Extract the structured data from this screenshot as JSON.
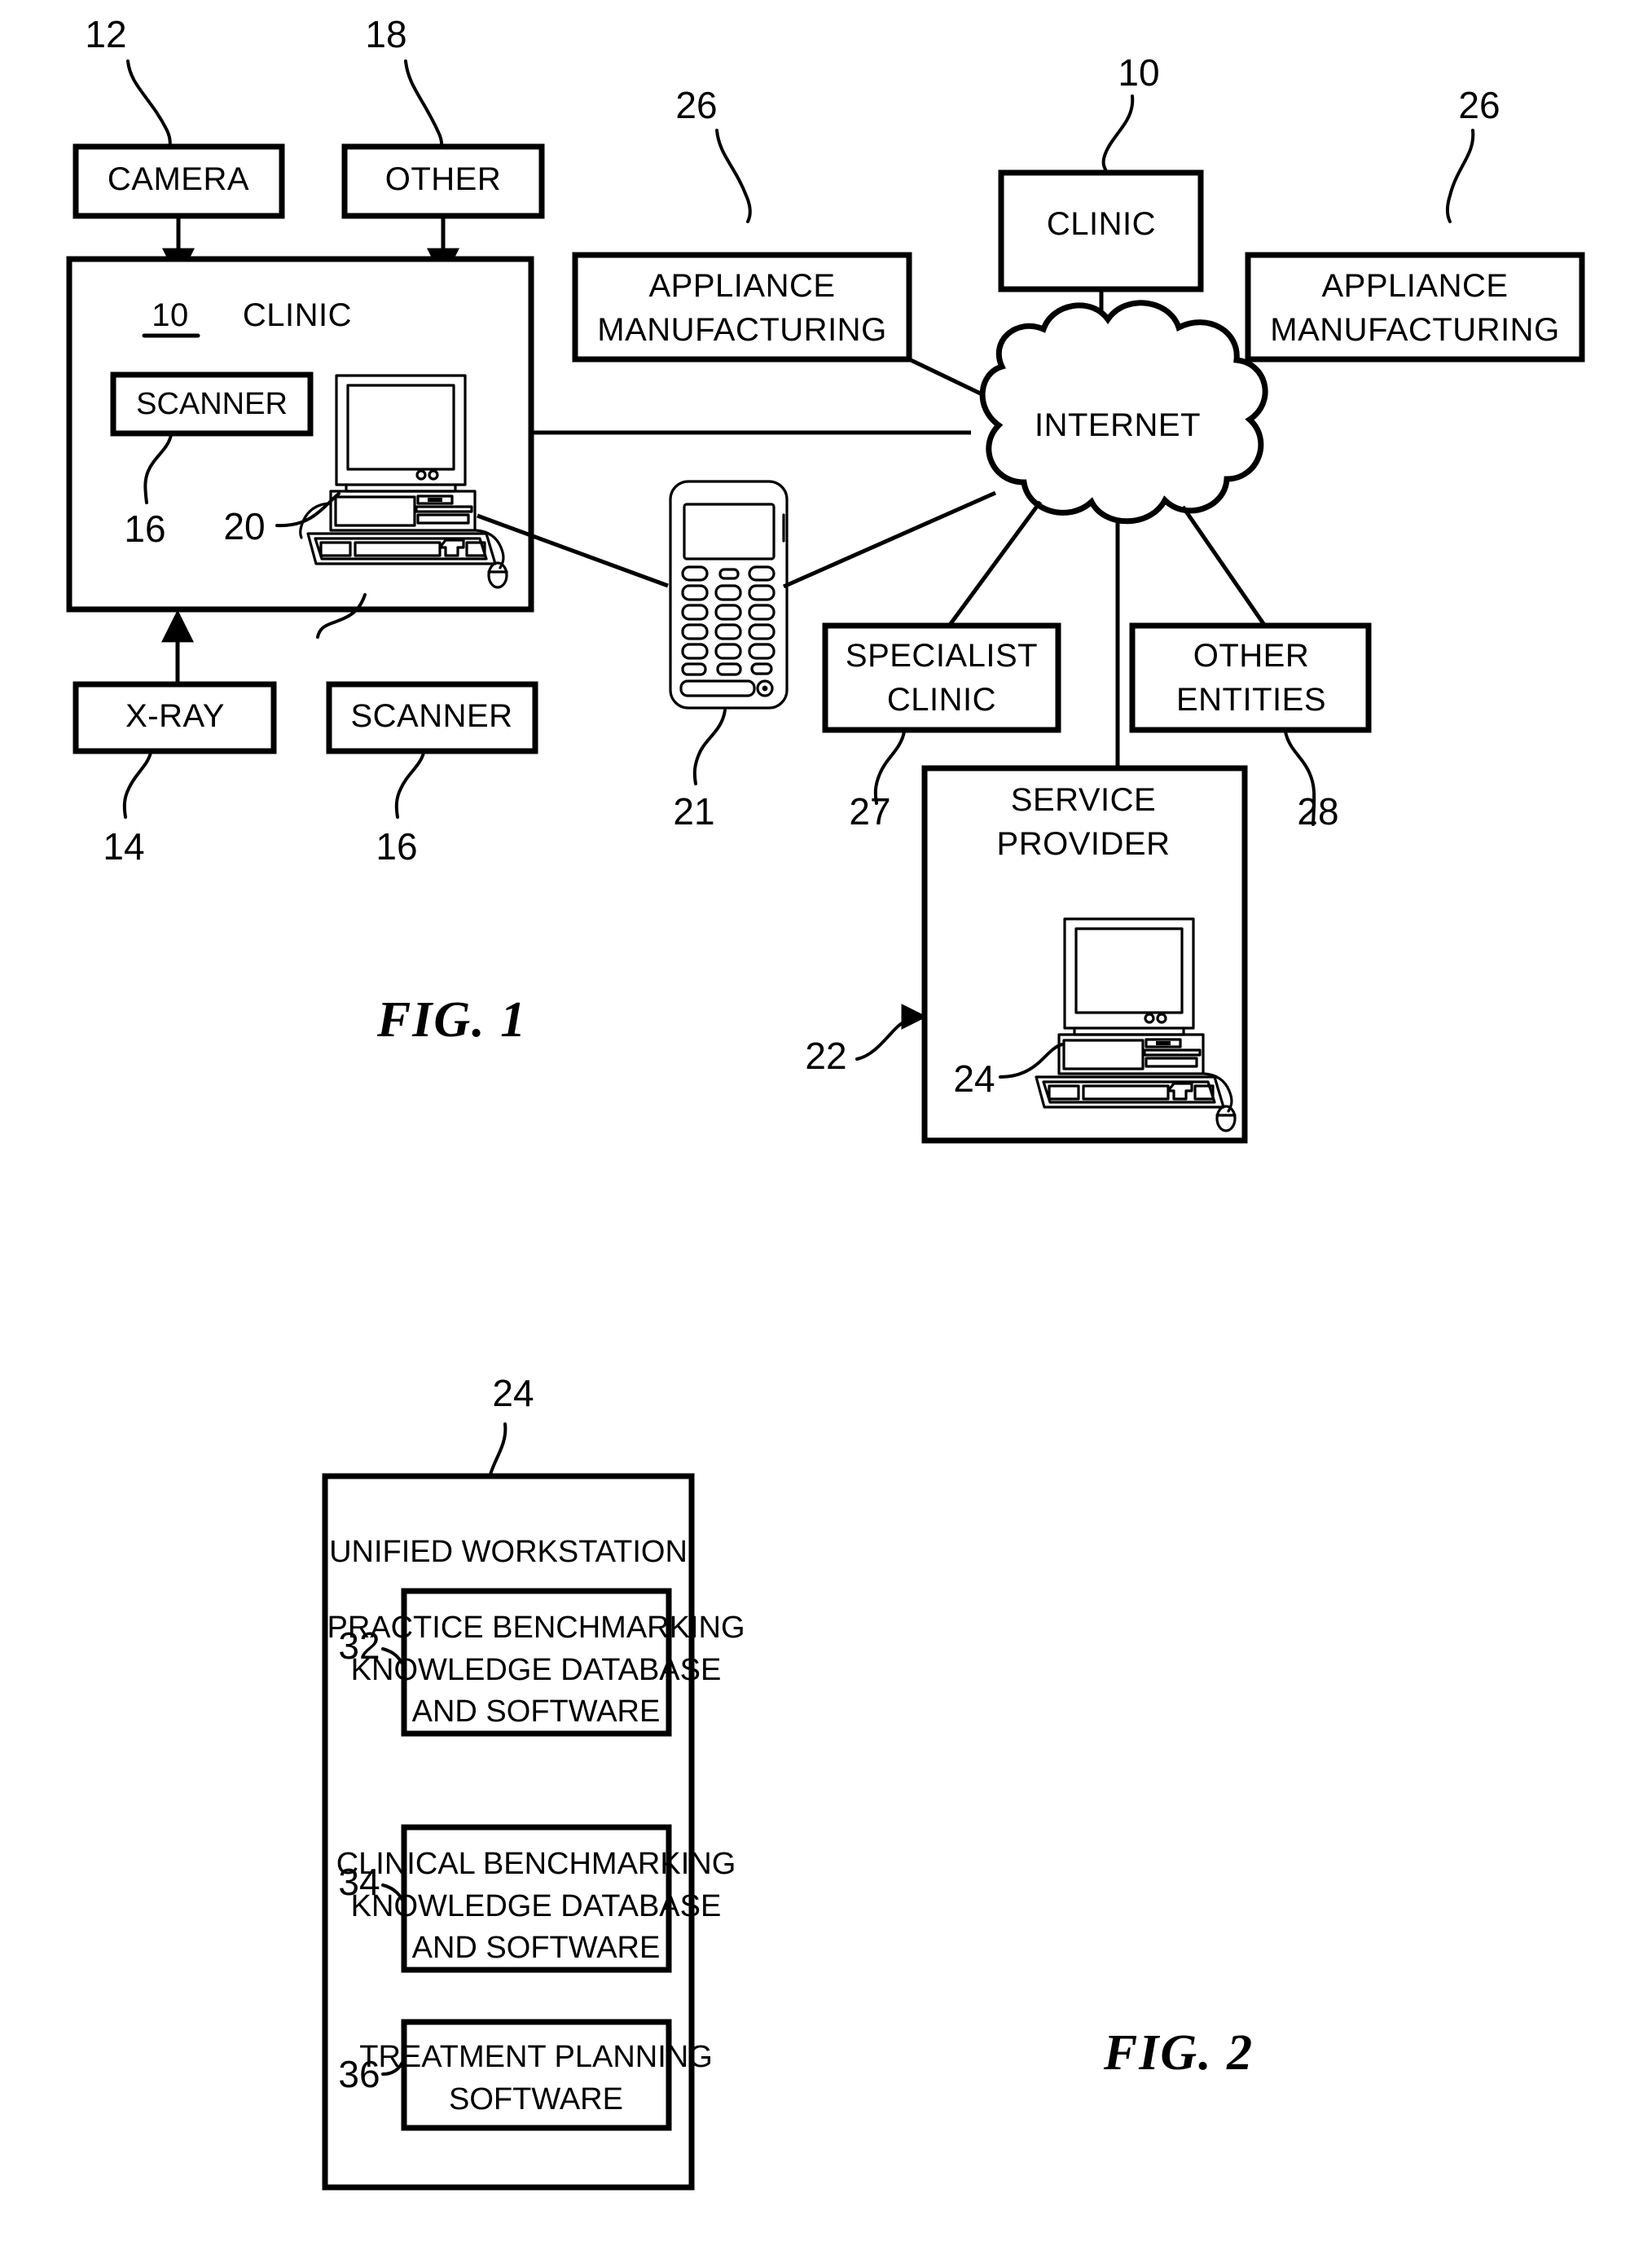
{
  "figures": [
    {
      "id": "fig1",
      "caption": "FIG. 1",
      "nodes": {
        "camera": {
          "label": "CAMERA",
          "ref": "12"
        },
        "other_input": {
          "label": "OTHER",
          "ref": "18"
        },
        "clinic_main": {
          "label": "CLINIC",
          "ref": "10"
        },
        "scanner_inner": {
          "label": "SCANNER",
          "ref": "16"
        },
        "workstation_ref": "20",
        "xray": {
          "label": "X-RAY",
          "ref": "14"
        },
        "scanner_bottom": {
          "label": "SCANNER",
          "ref": "16"
        },
        "mobile_phone": {
          "ref": "21"
        },
        "appliance_left": {
          "label_line1": "APPLIANCE",
          "label_line2": "MANUFACTURING",
          "ref": "26"
        },
        "appliance_right": {
          "label_line1": "APPLIANCE",
          "label_line2": "MANUFACTURING",
          "ref": "26"
        },
        "clinic_remote": {
          "label": "CLINIC",
          "ref": "10"
        },
        "internet": {
          "label": "INTERNET"
        },
        "specialist_clinic": {
          "label_line1": "SPECIALIST",
          "label_line2": "CLINIC",
          "ref": "27"
        },
        "other_entities": {
          "label_line1": "OTHER",
          "label_line2": "ENTITIES",
          "ref": "28"
        },
        "service_provider": {
          "label_line1": "SERVICE",
          "label_line2": "PROVIDER",
          "ref": "22",
          "computer_ref": "24"
        }
      }
    },
    {
      "id": "fig2",
      "caption": "FIG. 2",
      "nodes": {
        "unified_workstation": {
          "label": "UNIFIED WORKSTATION",
          "ref": "24"
        },
        "practice_db": {
          "line1": "PRACTICE BENCHMARKING",
          "line2": "KNOWLEDGE DATABASE",
          "line3": "AND SOFTWARE",
          "ref": "32"
        },
        "clinical_db": {
          "line1": "CLINICAL BENCHMARKING",
          "line2": "KNOWLEDGE DATABASE",
          "line3": "AND SOFTWARE",
          "ref": "34"
        },
        "treatment_sw": {
          "line1": "TREATMENT PLANNING",
          "line2": "SOFTWARE",
          "ref": "36"
        }
      }
    }
  ],
  "colors": {
    "ink": "#000000",
    "paper": "#ffffff"
  }
}
